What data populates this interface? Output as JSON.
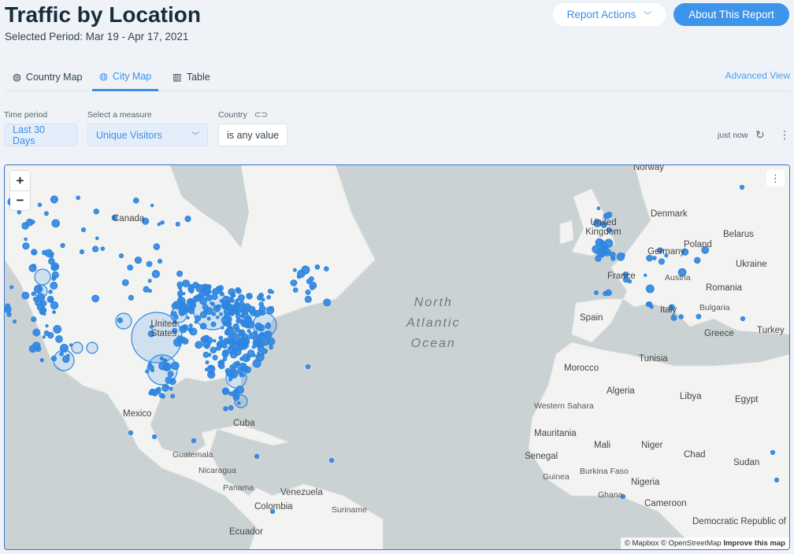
{
  "header": {
    "title": "Traffic by Location",
    "subtitle": "Selected Period: Mar 19 - Apr 17, 2021",
    "report_actions": "Report Actions",
    "about": "About This Report"
  },
  "tabs": [
    {
      "label": "Country Map",
      "icon": "globe-icon"
    },
    {
      "label": "City Map",
      "icon": "globe-icon",
      "active": true
    },
    {
      "label": "Table",
      "icon": "table-icon"
    }
  ],
  "advanced_view": "Advanced View",
  "filters": {
    "time_label": "Time period",
    "time_value": "Last 30 Days",
    "measure_label": "Select a measure",
    "measure_value": "Unique Visitors",
    "country_label": "Country",
    "country_value": "is any value"
  },
  "status": {
    "updated": "just now"
  },
  "map": {
    "zoom_in": "+",
    "zoom_out": "−",
    "ocean_label": [
      "North",
      "Atlantic",
      "Ocean"
    ],
    "labels": [
      "Canada",
      "United States",
      "Mexico",
      "Cuba",
      "Guatemala",
      "Nicaragua",
      "Panama",
      "Venezuela",
      "Colombia",
      "Suriname",
      "Ecuador",
      "Norway",
      "Denmark",
      "United Kingdom",
      "Poland",
      "Belarus",
      "Germany",
      "Ukraine",
      "France",
      "Austria",
      "Romania",
      "Spain",
      "Italy",
      "Bulgaria",
      "Greece",
      "Turkey",
      "Tunisia",
      "Morocco",
      "Algeria",
      "Libya",
      "Egypt",
      "Western Sahara",
      "Mauritania",
      "Mali",
      "Niger",
      "Chad",
      "Sudan",
      "Senegal",
      "Guinea",
      "Burkina Faso",
      "Ghana",
      "Nigeria",
      "Cameroon",
      "Democratic Republic of"
    ],
    "attribution": "© Mapbox © OpenStreetMap",
    "improve": "Improve this map",
    "marker_color": "#2f86e0"
  }
}
